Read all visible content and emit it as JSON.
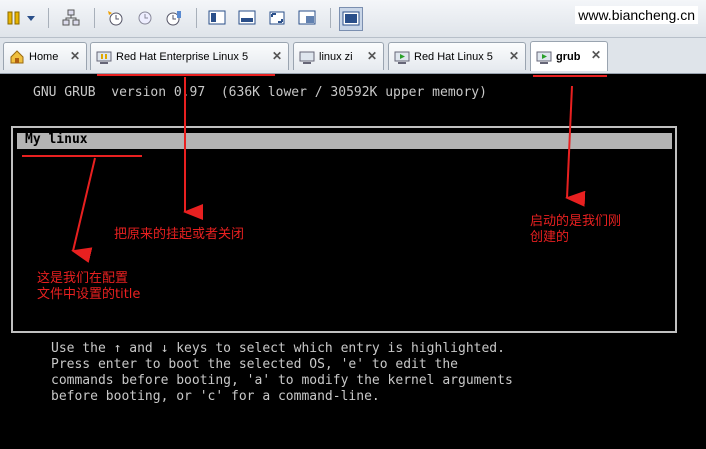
{
  "watermark": "www.biancheng.cn",
  "tabs": [
    {
      "label": "Home",
      "icon": "home-icon"
    },
    {
      "label": "Red Hat Enterprise Linux 5",
      "icon": "vm-paused-icon"
    },
    {
      "label": "linux zi",
      "icon": "vm-off-icon"
    },
    {
      "label": "Red Hat Linux 5",
      "icon": "vm-running-icon"
    },
    {
      "label": "grub",
      "icon": "vm-running-icon",
      "active": true
    }
  ],
  "tab_close": "✕",
  "grub": {
    "header": "GNU GRUB  version 0.97  (636K lower / 30592K upper memory)",
    "entries": [
      "My linux"
    ],
    "help": [
      "Use the ↑ and ↓ keys to select which entry is highlighted.",
      "Press enter to boot the selected OS, 'e' to edit the",
      "commands before booting, 'a' to modify the kernel arguments",
      "before booting, or 'c' for a command-line."
    ]
  },
  "annotations": {
    "suspend": "把原来的挂起或者关闭",
    "started": "启动的是我们刚\n创建的",
    "title_note": "这是我们在配置\n文件中设置的title"
  },
  "colors": {
    "annotation": "#e82020",
    "highlight": "#b4b4b4",
    "terminal_text": "#c8c8c8"
  }
}
